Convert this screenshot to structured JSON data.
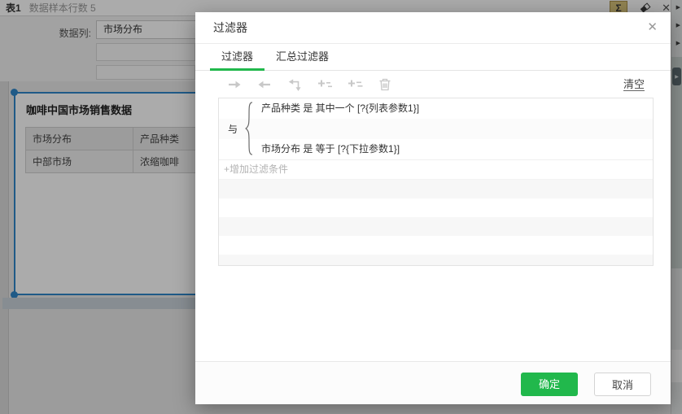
{
  "background": {
    "topbar": {
      "table_label": "表1",
      "sample_info": "数据样本行数 5",
      "sigma_glyph": "Σ",
      "close_glyph": "✕"
    },
    "form": {
      "data_column_label": "数据列:",
      "data_column_value": "市场分布"
    },
    "card": {
      "title": "咖啡中国市场销售数据",
      "table": {
        "headers": [
          "市场分布",
          "产品种类"
        ],
        "rows": [
          [
            "中部市场",
            "浓缩咖啡"
          ]
        ]
      }
    }
  },
  "dialog": {
    "title": "过滤器",
    "close_glyph": "✕",
    "tabs": [
      {
        "label": "过滤器",
        "active": true
      },
      {
        "label": "汇总过滤器",
        "active": false
      }
    ],
    "toolbar": {
      "icons": [
        "arrow-right",
        "arrow-left",
        "move-to-sublevel",
        "add-sub-condition",
        "add-sub-group",
        "trash"
      ],
      "clear_label": "清空"
    },
    "filter": {
      "operator": "与",
      "conditions": [
        "产品种类 是 其中一个 [?{列表参数1}]",
        "市场分布 是 等于 [?{下拉参数1}]"
      ],
      "add_label": "+增加过滤条件"
    },
    "footer": {
      "ok_label": "确定",
      "cancel_label": "取消"
    }
  },
  "colors": {
    "accent_green": "#21b84c",
    "selection_blue": "#2f86c9"
  }
}
